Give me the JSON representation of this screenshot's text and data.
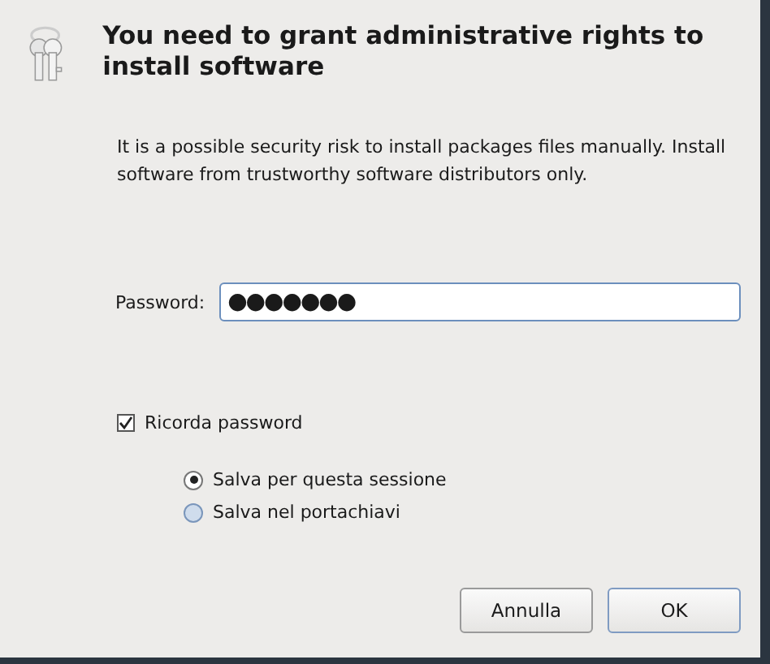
{
  "dialog": {
    "title": "You need to grant administrative rights to install software",
    "message": "It is a possible security risk to install packages files manually. Install software from trustworthy software distributors only.",
    "password": {
      "label": "Password:",
      "value": "●●●●●●●"
    },
    "remember": {
      "label": "Ricorda password",
      "checked": true
    },
    "options": [
      {
        "label": "Salva per questa sessione",
        "selected": true
      },
      {
        "label": "Salva nel portachiavi",
        "selected": false
      }
    ],
    "buttons": [
      {
        "label": "Annulla",
        "default": false
      },
      {
        "label": "OK",
        "default": true
      }
    ]
  }
}
